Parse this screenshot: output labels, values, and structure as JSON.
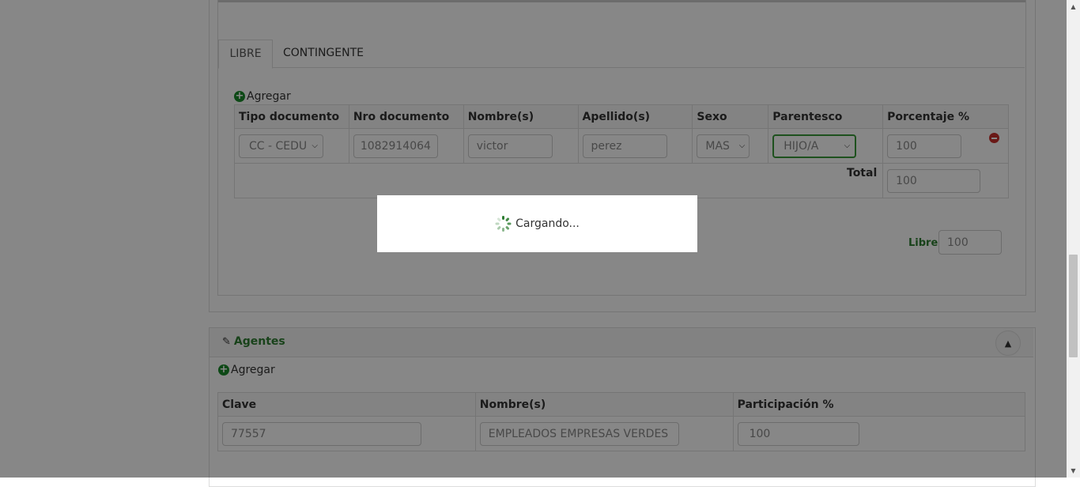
{
  "beneficiarios": {
    "tabs": [
      {
        "label": "LIBRE"
      },
      {
        "label": "CONTINGENTE"
      }
    ],
    "add_label": "Agregar",
    "columns": [
      "Tipo documento",
      "Nro documento",
      "Nombre(s)",
      "Apellido(s)",
      "Sexo",
      "Parentesco",
      "Porcentaje %"
    ],
    "rows": [
      {
        "tipo_documento": "CC - CEDU",
        "nro_documento": "1082914064",
        "nombre": "victor",
        "apellido": "perez",
        "sexo": "MAS",
        "parentesco": "HIJO/A",
        "porcentaje": "100"
      }
    ],
    "total_label": "Total",
    "total_value": "100",
    "libre_label": "Libre:",
    "libre_value": "100"
  },
  "agentes": {
    "title": "Agentes",
    "add_label": "Agregar",
    "columns": [
      "Clave",
      "Nombre(s)",
      "Participación %"
    ],
    "rows": [
      {
        "clave": "77557",
        "nombre": "EMPLEADOS EMPRESAS VERDES",
        "participacion": "100"
      }
    ]
  },
  "loading": {
    "text": "Cargando..."
  },
  "colors": {
    "accent_green": "#2e7d32",
    "danger": "#c9302c"
  }
}
